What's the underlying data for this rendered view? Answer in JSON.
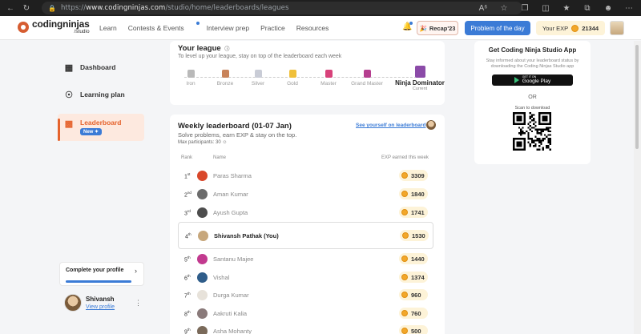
{
  "browser": {
    "url_prefix": "https://",
    "url_host": "www.codingninjas.com",
    "url_path": "/studio/home/leaderboards/leagues"
  },
  "header": {
    "logo_name": "codingninjas",
    "logo_sub": "/studio",
    "nav": [
      "Learn",
      "Contests & Events",
      "Interview prep",
      "Practice",
      "Resources"
    ],
    "recap_label": "Recap'23",
    "potd_label": "Problem of the day",
    "exp_label": "Your EXP",
    "exp_value": "21344"
  },
  "sidebar": {
    "items": [
      {
        "label": "Dashboard",
        "icon": "dashboard-icon"
      },
      {
        "label": "Learning plan",
        "icon": "target-icon"
      },
      {
        "label": "Leaderboard",
        "icon": "leaderboard-icon",
        "badge": "New"
      }
    ],
    "profile_prompt": "Complete your profile",
    "user_name": "Shivansh",
    "user_link": "View profile"
  },
  "league": {
    "title": "Your league",
    "subtitle": "To level up your league, stay on top of the leaderboard each week",
    "tiers": [
      "Iron",
      "Bronze",
      "Silver",
      "Gold",
      "Master",
      "Grand Master",
      "Ninja Dominator"
    ],
    "current_tier_note": "Current",
    "tier_colors": [
      "#b9b9b9",
      "#c8835a",
      "#c9ccd6",
      "#f0c03a",
      "#d8427a",
      "#b53e8f",
      "#8b4ba8"
    ]
  },
  "leaderboard": {
    "title": "Weekly leaderboard (01-07 Jan)",
    "subtitle": "Solve problems, earn EXP & stay on the top.",
    "max_participants": "Max participants: 30",
    "see_yourself": "See yourself on leaderboard",
    "col_rank": "Rank",
    "col_name": "Name",
    "col_exp": "EXP earned this week",
    "rows": [
      {
        "rank": "1",
        "suffix": "st",
        "name": "Paras Sharma",
        "exp": "3309",
        "avatar_color": "#d9482b"
      },
      {
        "rank": "2",
        "suffix": "nd",
        "name": "Aman Kumar",
        "exp": "1840",
        "avatar_color": "#6b6b6b"
      },
      {
        "rank": "3",
        "suffix": "rd",
        "name": "Ayush Gupta",
        "exp": "1741",
        "avatar_color": "#4d4d4d"
      },
      {
        "rank": "4",
        "suffix": "th",
        "name": "Shivansh Pathak (You)",
        "exp": "1530",
        "avatar_color": "#c7a77c"
      },
      {
        "rank": "5",
        "suffix": "th",
        "name": "Santanu Majee",
        "exp": "1440",
        "avatar_color": "#c23a8f"
      },
      {
        "rank": "6",
        "suffix": "th",
        "name": "Vishal",
        "exp": "1374",
        "avatar_color": "#2f5d8a"
      },
      {
        "rank": "7",
        "suffix": "th",
        "name": "Durga Kumar",
        "exp": "960",
        "avatar_color": "#e7e2da"
      },
      {
        "rank": "8",
        "suffix": "th",
        "name": "Aakruti Kalia",
        "exp": "760",
        "avatar_color": "#8a7a7a"
      },
      {
        "rank": "9",
        "suffix": "th",
        "name": "Asha Mohanty",
        "exp": "500",
        "avatar_color": "#7a6a5a"
      }
    ]
  },
  "app_panel": {
    "title": "Get Coding Ninja Studio App",
    "subtitle": "Stay informed about your leaderboard status by downloading the Coding Ninjas Studio app",
    "store_small": "GET IT ON",
    "store_big": "Google Play",
    "or_label": "OR",
    "scan_label": "Scan to download"
  }
}
